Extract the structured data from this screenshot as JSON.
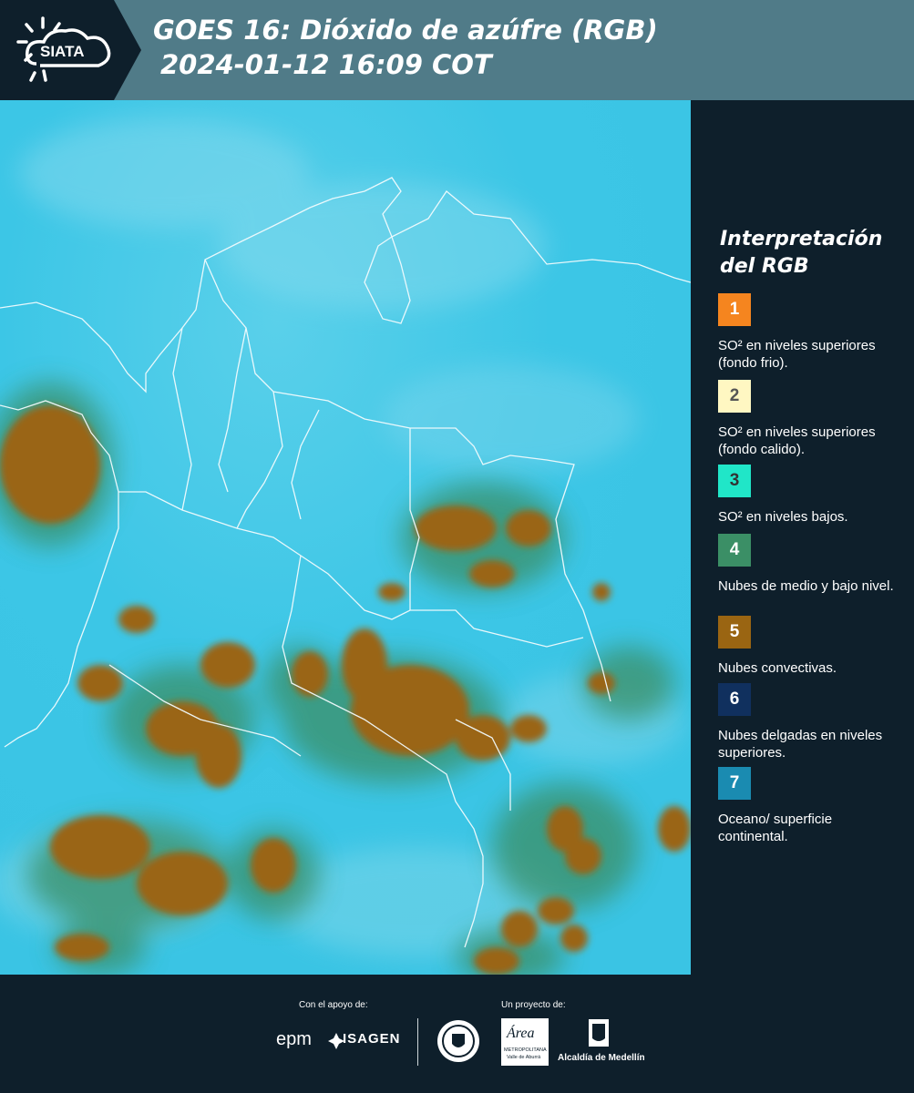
{
  "header": {
    "logo_text": "SIATA",
    "title_line1": "GOES 16: Dióxido de azúfre (RGB)",
    "title_line2": "2024-01-12 16:09 COT"
  },
  "legend": {
    "title": "Interpretación del RGB",
    "items": [
      {
        "number": "1",
        "label": "SO² en niveles superiores (fondo frio).",
        "color": "#f5851f",
        "text_color": "#ffffff"
      },
      {
        "number": "2",
        "label": "SO² en niveles superiores (fondo calido).",
        "color": "#fff7c2",
        "text_color": "#555555"
      },
      {
        "number": "3",
        "label": "SO² en niveles bajos.",
        "color": "#20e6c8",
        "text_color": "#333333"
      },
      {
        "number": "4",
        "label": "Nubes de medio y bajo nivel.",
        "color": "#3b8f66",
        "text_color": "#ffffff"
      },
      {
        "number": "5",
        "label": "Nubes convectivas.",
        "color": "#9a6512",
        "text_color": "#ffffff"
      },
      {
        "number": "6",
        "label": "Nubes delgadas en niveles superiores.",
        "color": "#10305e",
        "text_color": "#ffffff"
      },
      {
        "number": "7",
        "label": "Oceano/ superficie continental.",
        "color": "#1a8bb1",
        "text_color": "#ffffff"
      }
    ]
  },
  "footer": {
    "support_label": "Con el apoyo de:",
    "project_label": "Un proyecto de:",
    "sponsors": [
      "epm",
      "ISAGEN"
    ],
    "partners": [
      "Área Metropolitana Valle de Aburrá",
      "Alcaldía de Medellín"
    ],
    "area_logo_text": "Área",
    "area_sub1": "METROPOLITANA",
    "area_sub2": "Valle de Aburrá",
    "alcaldia_text": "Alcaldía de Medellín"
  },
  "colors": {
    "header_bg": "#507b88",
    "panel_bg": "#0e1f2b",
    "ocean": "#34c8e8",
    "convective": "#9a6512",
    "mid_low_cloud": "#3b8f66"
  }
}
